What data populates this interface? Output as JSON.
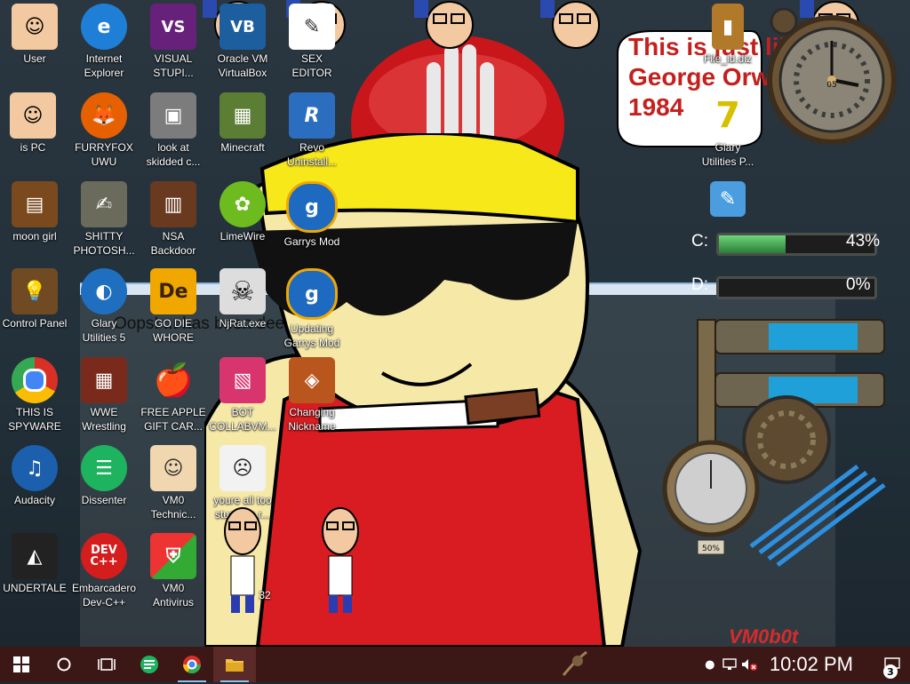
{
  "wallpaper": {
    "bubble_lines": [
      "This is just like",
      "George Orwell's",
      "1984"
    ],
    "web_text": "Oops! ... has been deemed inap...",
    "brand": "VM0b0t"
  },
  "desktop_icons": [
    {
      "label": "User",
      "glyph": "",
      "bg": "#3a6ea8"
    },
    {
      "label": "Internet\nExplorer",
      "glyph": "e",
      "bg": "#1f7fd6"
    },
    {
      "label": "VISUAL\nSTUPI...",
      "glyph": "VS",
      "bg": "#68217a"
    },
    {
      "label": "Oracle VM\nVirtualBox",
      "glyph": "VB",
      "bg": "#1d5e9e"
    },
    {
      "label": "SEX\nEDITOR",
      "glyph": "✎",
      "bg": "#ffffff"
    },
    {
      "label": "is PC",
      "glyph": "",
      "bg": "#3a6ea8"
    },
    {
      "label": "FURRYFOX\nUWU",
      "glyph": "🦊",
      "bg": "#e66000"
    },
    {
      "label": "look at\nskidded c...",
      "glyph": "▣",
      "bg": "#7c7c7c"
    },
    {
      "label": "Minecraft",
      "glyph": "▦",
      "bg": "#5b7d34"
    },
    {
      "label": "Revo\nUninstall...",
      "glyph": "R",
      "bg": "#2b6ec0"
    },
    {
      "label": "moon girl",
      "glyph": "▤",
      "bg": "#7a4a1e"
    },
    {
      "label": "SHITTY\nPHOTOSH...",
      "glyph": "✍",
      "bg": "#6b6b5c"
    },
    {
      "label": "NSA\nBackdoor",
      "glyph": "▥",
      "bg": "#6a3a20"
    },
    {
      "label": "LimeWire",
      "glyph": "✿",
      "bg": "#6dbb1f"
    },
    {
      "label": "Garrys Mod",
      "glyph": "g",
      "bg": "#1e6ac0"
    },
    {
      "label": "Control Panel",
      "glyph": "💡",
      "bg": "#704a22"
    },
    {
      "label": "Glary\nUtilities 5",
      "glyph": "◐",
      "bg": "#1f6fc0"
    },
    {
      "label": "GO DIE\nWHORE",
      "glyph": "De",
      "bg": "#f0a800"
    },
    {
      "label": "NjRat.exe",
      "glyph": "☠",
      "bg": "#dddddd"
    },
    {
      "label": "Updating\nGarrys Mod",
      "glyph": "g",
      "bg": "#1e6ac0"
    },
    {
      "label": "THIS IS\nSPYWARE",
      "glyph": "◉",
      "bg": "#d93025"
    },
    {
      "label": "WWE\nWrestling",
      "glyph": "▦",
      "bg": "#7a2a1a"
    },
    {
      "label": "FREE APPLE\nGIFT CAR...",
      "glyph": "🍎",
      "bg": "#c82020"
    },
    {
      "label": "BOT\nCOLLABVM...",
      "glyph": "▧",
      "bg": "#d8356e"
    },
    {
      "label": "Changing\nNickname",
      "glyph": "◈",
      "bg": "#b8561d"
    },
    {
      "label": "Audacity",
      "glyph": "♫",
      "bg": "#1b5fad"
    },
    {
      "label": "Dissenter",
      "glyph": "☰",
      "bg": "#1eb35e"
    },
    {
      "label": "VM0\nTechnic...",
      "glyph": "☺",
      "bg": "#f0d7b0"
    },
    {
      "label": "youre all too\nstupid to r...",
      "glyph": "☹",
      "bg": "#f2f2f2"
    },
    {
      "label": "UNDERTALE",
      "glyph": "◭",
      "bg": "#222222"
    },
    {
      "label": "Embarcadero\nDev-C++",
      "glyph": "DEV\nC++",
      "bg": "#d51d1d"
    },
    {
      "label": "VM0\nAntivirus",
      "glyph": "⛨",
      "bg": "#2a6ec0"
    },
    {
      "label": "32",
      "glyph": "",
      "bg": "#3a6ea8"
    },
    {
      "label": "File_id.diz",
      "glyph": "▮",
      "bg": "#b07a2a"
    },
    {
      "label": "Glary\nUtilities P...",
      "glyph": "7",
      "bg": "#c9a400"
    },
    {
      "label": "",
      "glyph": "✎",
      "bg": "#4a9ee0"
    }
  ],
  "widgets": {
    "clock_number": "05",
    "drives": [
      {
        "letter": "C:",
        "percent_label": "43%",
        "fill": 0.43
      },
      {
        "letter": "D:",
        "percent_label": "0%",
        "fill": 0.0
      }
    ],
    "gauge_label": "50%"
  },
  "taskbar": {
    "start": "windows-start",
    "search": "search-circle",
    "task_view": "task-view",
    "apps": [
      "dissenter",
      "chrome",
      "file-explorer"
    ],
    "time": "10:02 PM",
    "notification_count": "3"
  }
}
